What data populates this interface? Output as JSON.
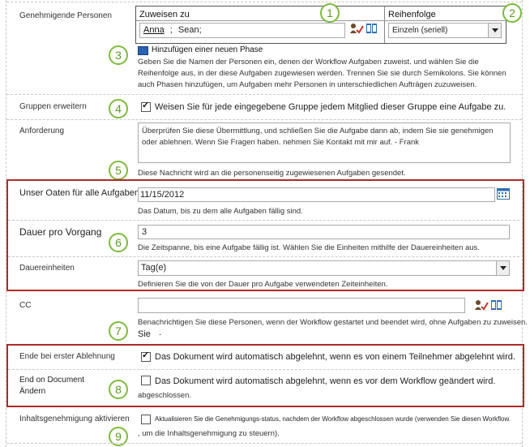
{
  "approvers": {
    "label": "Genehmigende Personen",
    "assign_header": "Zuweisen zu",
    "order_header": "Reihenfolge",
    "assignee_1": "Anna",
    "assignee_sep": ";",
    "assignee_2": "Sean;",
    "order_value": "Einzeln (seriell)",
    "add_stage": "Hinzufügen einer neuen Phase",
    "description": "Geben Sie die Namen der Personen ein, denen der Workflow Aufgaben zuweist. und wählen Sie die Reihenfolge aus, in der diese Aufgaben zugewiesen werden. Trennen Sie sie durch Semikolons. Sie können auch Phasen hinzufügen, um Aufgaben mehr Personen in unterschiedlichen Aufträgen zuzuweisen."
  },
  "expand_groups": {
    "label": "Gruppen erweitern",
    "checkbox_text": "Weisen Sie für jede eingegebene Gruppe jedem Mitglied dieser Gruppe eine Aufgabe zu."
  },
  "request": {
    "label": "Anforderung",
    "text": "Überprüfen Sie diese Übermittlung, und schließen Sie die Aufgabe dann ab, indem Sie sie genehmigen oder ablehnen. Wenn Sie Fragen haben. nehmen Sie Kontakt mit mir auf. - Frank",
    "description": "Diese Nachricht wird an die personenseitig zugewiesenen Aufgaben gesendet."
  },
  "due_date": {
    "label": "Unser Oaten für alle Aufgaben",
    "value": "11/15/2012",
    "description": "Das Datum, bis zu dem alle Aufgaben fällig sind."
  },
  "duration": {
    "label": "Dauer pro Vorgang",
    "value": "3",
    "description": "Die Zeitspanne, bis eine Aufgabe fällig ist. Wählen Sie die Einheiten mithilfe der Dauereinheiten aus."
  },
  "duration_units": {
    "label": "Dauereinheiten",
    "value": "Tag(e)",
    "description": "Definieren Sie die von der Dauer pro Aufgabe verwendeten Zeiteinheiten."
  },
  "cc": {
    "label": "CC",
    "value": "",
    "description_1": "Benachrichtigen Sie diese Personen, wenn der Workflow gestartet und beendet wird, ohne Aufgaben zu zuweisen.",
    "description_2": "Sie"
  },
  "end_first_reject": {
    "label": "Ende bei erster Ablehnung",
    "checkbox_text": "Das Dokument wird automatisch abgelehnt, wenn es von einem Teilnehmer abgelehnt wird."
  },
  "end_doc_change": {
    "label": "End on Document Ändern",
    "checkbox_text": "Das Dokument wird automatisch abgelehnt, wenn es vor dem Workflow geändert wird.",
    "checkbox_text_2": "abgeschlossen."
  },
  "content_approval": {
    "label": "Inhaltsgenehmigung aktivieren",
    "checkbox_text": "Aktualisieren Sie die Genehmigungs-status, nachdem der Workflow abgeschlossen wurde (verwenden Sie diesen Workflow.",
    "checkbox_text_2": ", um die Inhaltsgenehmigung zu steuern)."
  },
  "callouts": [
    "1",
    "2",
    "3",
    "4",
    "5",
    "6",
    "7",
    "8",
    "9"
  ],
  "colors": {
    "callout_green": "#7cbb3c",
    "highlight_red": "#b02a2a",
    "link_blue": "#1f4e9a"
  }
}
